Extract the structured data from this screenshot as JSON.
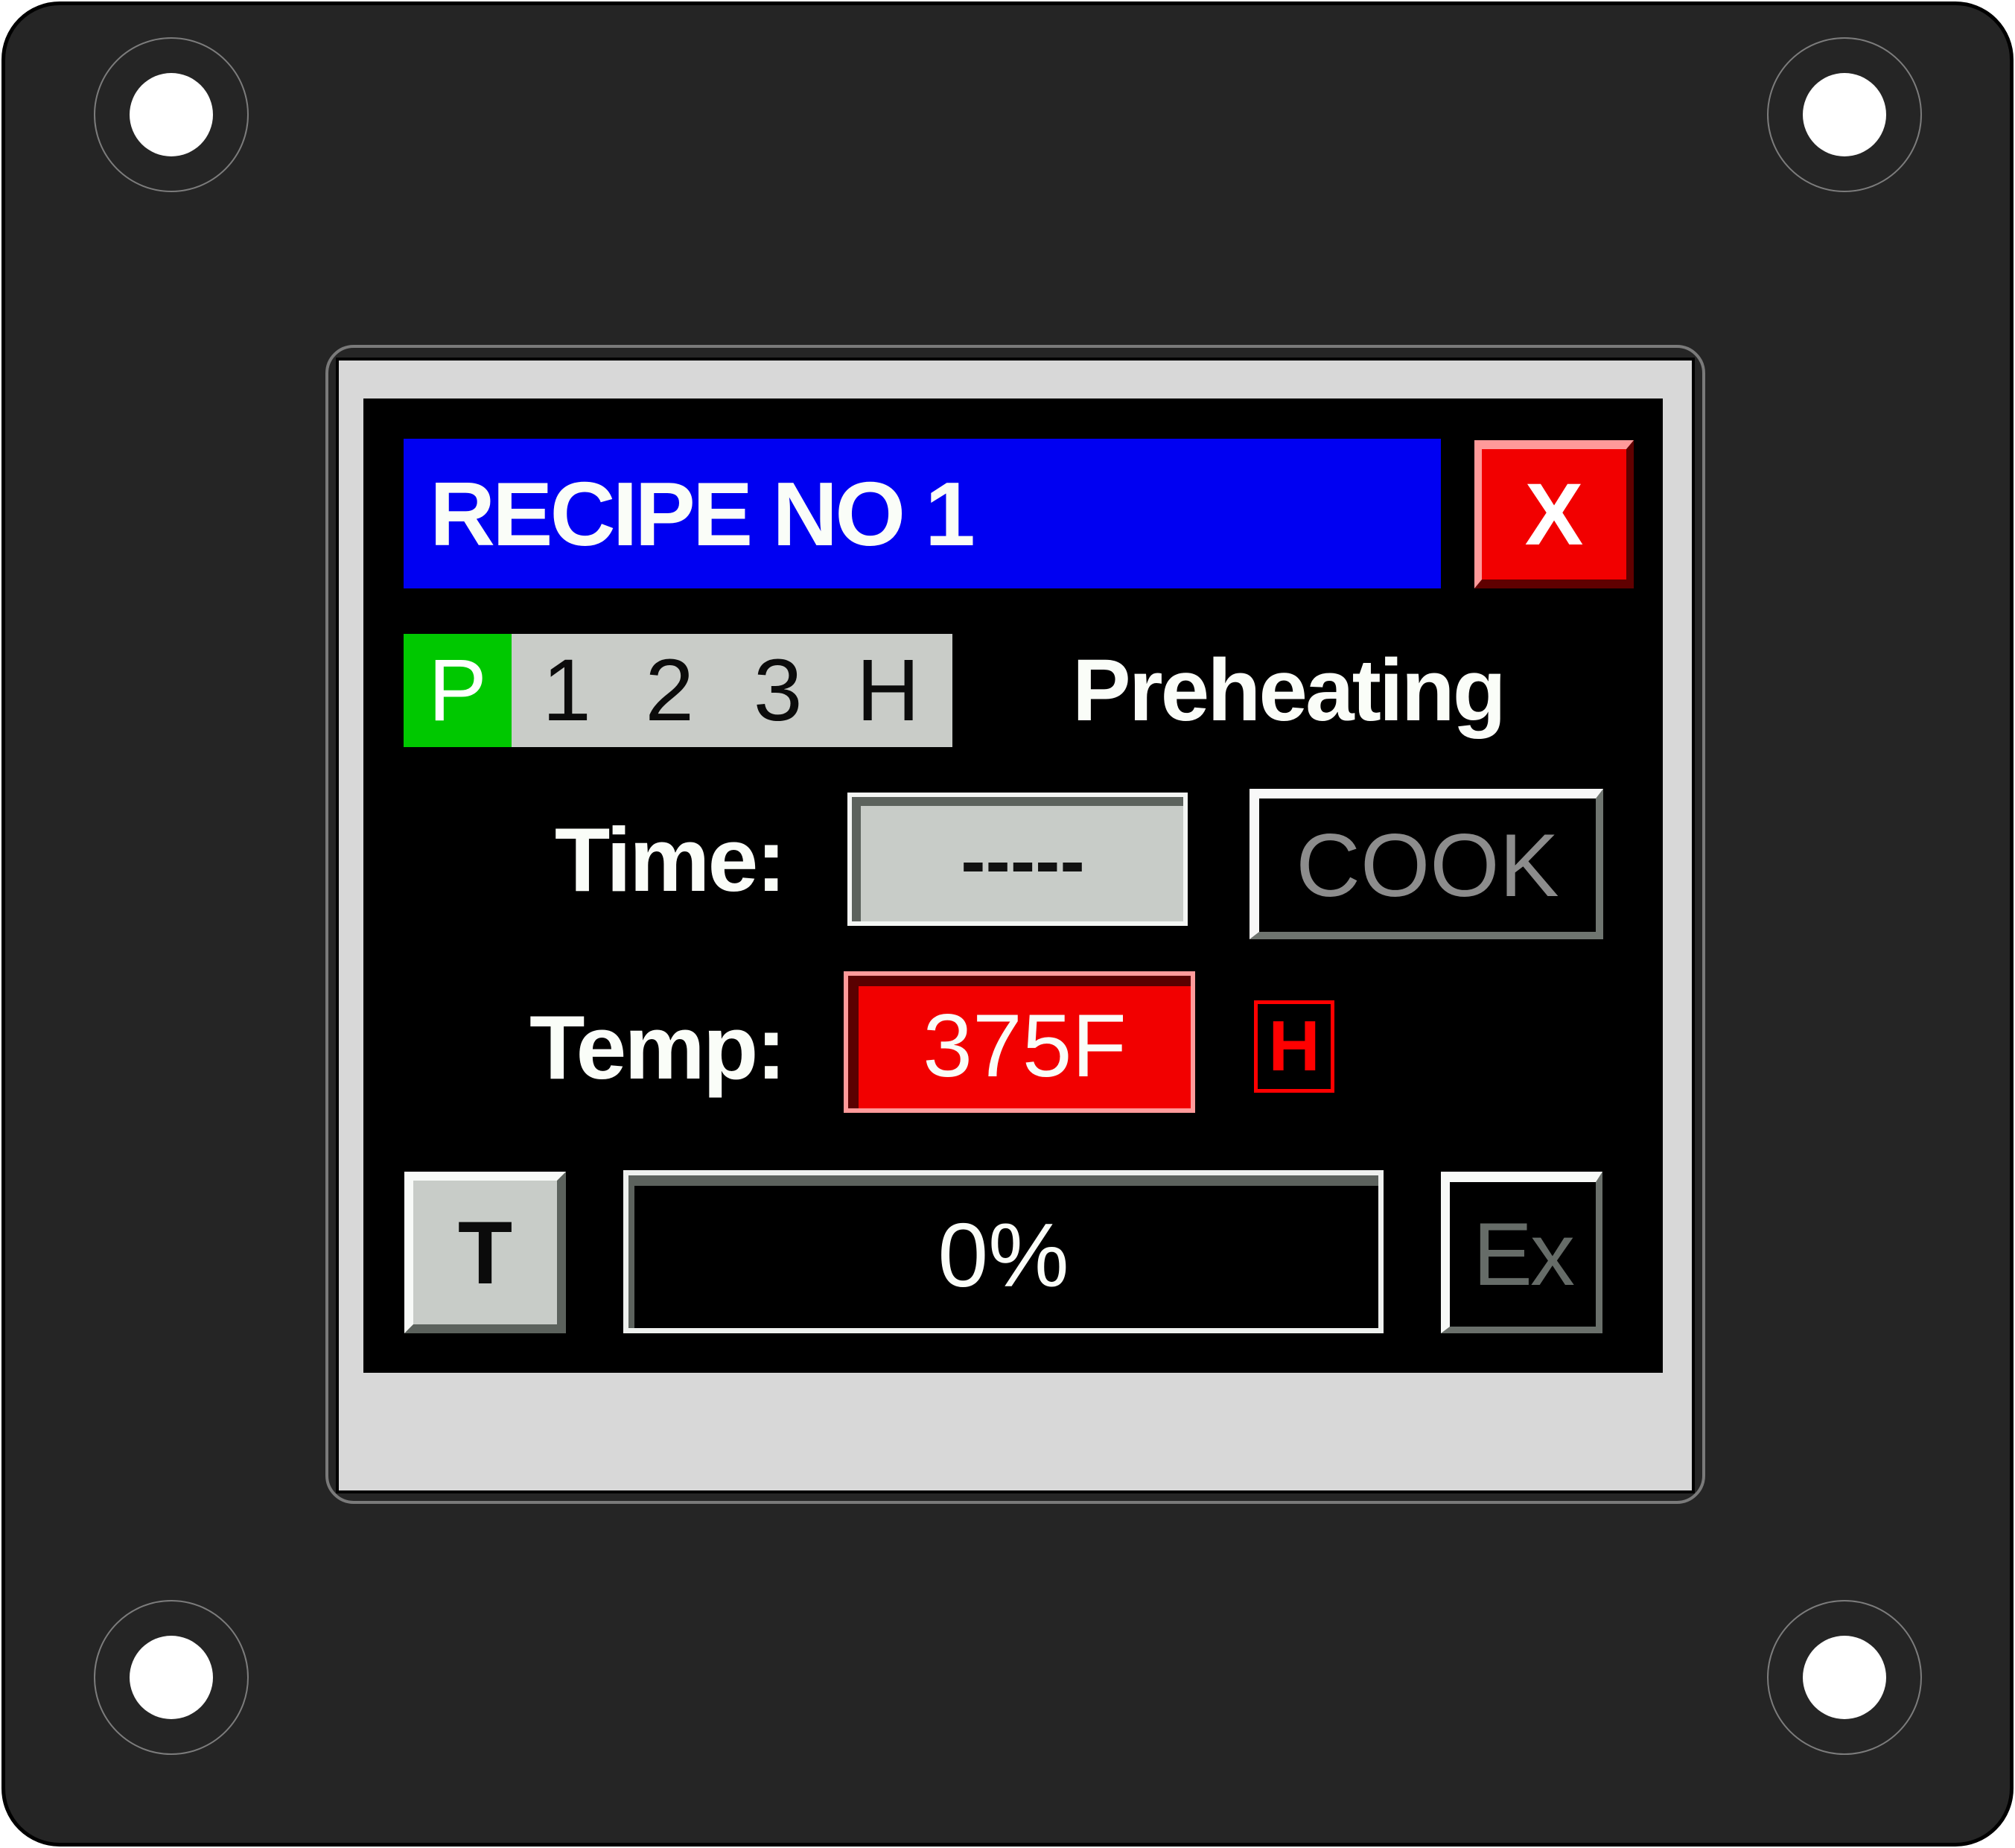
{
  "hmi": {
    "title": "RECIPE NO 1",
    "close_button": "X",
    "stages": [
      {
        "label": "P",
        "active": true
      },
      {
        "label": "1",
        "active": false
      },
      {
        "label": "2",
        "active": false
      },
      {
        "label": "3",
        "active": false
      },
      {
        "label": "H",
        "active": false
      }
    ],
    "status": "Preheating",
    "time": {
      "label": "Time:",
      "value": "-----"
    },
    "cook_button": "COOK",
    "temp": {
      "label": "Temp:",
      "value": "375F"
    },
    "heat_indicator": "H",
    "t_button": "T",
    "progress": {
      "text": "0%",
      "percent": 0
    },
    "exit_button": "Ex"
  },
  "colors": {
    "title_bar": "#0000f2",
    "close_button": "#f20000",
    "active_stage": "#00c800",
    "temp_field": "#f20000",
    "heat_indicator": "#ff0000",
    "screen_bg": "#000000",
    "plate": "#252525"
  }
}
